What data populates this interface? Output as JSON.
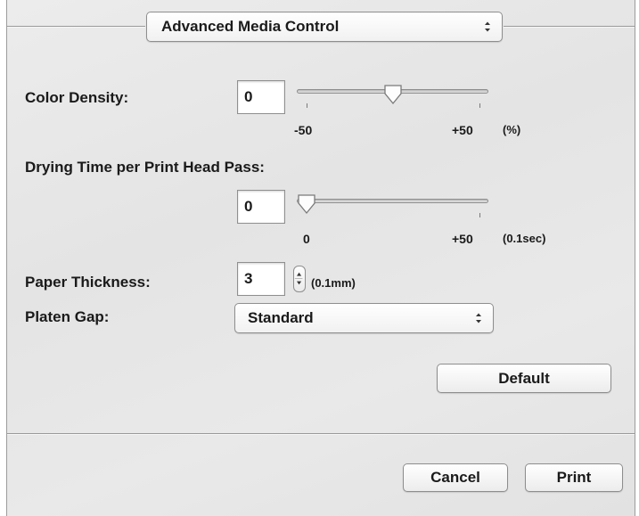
{
  "header": {
    "panel_popup": "Advanced Media Control"
  },
  "color_density": {
    "label": "Color Density:",
    "value": "0",
    "slider_min_label": "-50",
    "slider_max_label": "+50",
    "unit": "(%)",
    "slider_min": -50,
    "slider_max": 50,
    "slider_value": 0
  },
  "drying_time": {
    "label": "Drying Time per Print Head Pass:",
    "value": "0",
    "slider_min_label": "0",
    "slider_max_label": "+50",
    "unit": "(0.1sec)",
    "slider_min": 0,
    "slider_max": 50,
    "slider_value": 0
  },
  "paper_thickness": {
    "label": "Paper Thickness:",
    "value": "3",
    "unit": "(0.1mm)"
  },
  "platen_gap": {
    "label": "Platen Gap:",
    "selected": "Standard"
  },
  "buttons": {
    "default": "Default",
    "cancel": "Cancel",
    "print": "Print"
  },
  "icons": {
    "popup_arrows": "up-down-arrows-icon",
    "slider_thumb": "slider-thumb-icon",
    "stepper": "stepper-icon"
  }
}
